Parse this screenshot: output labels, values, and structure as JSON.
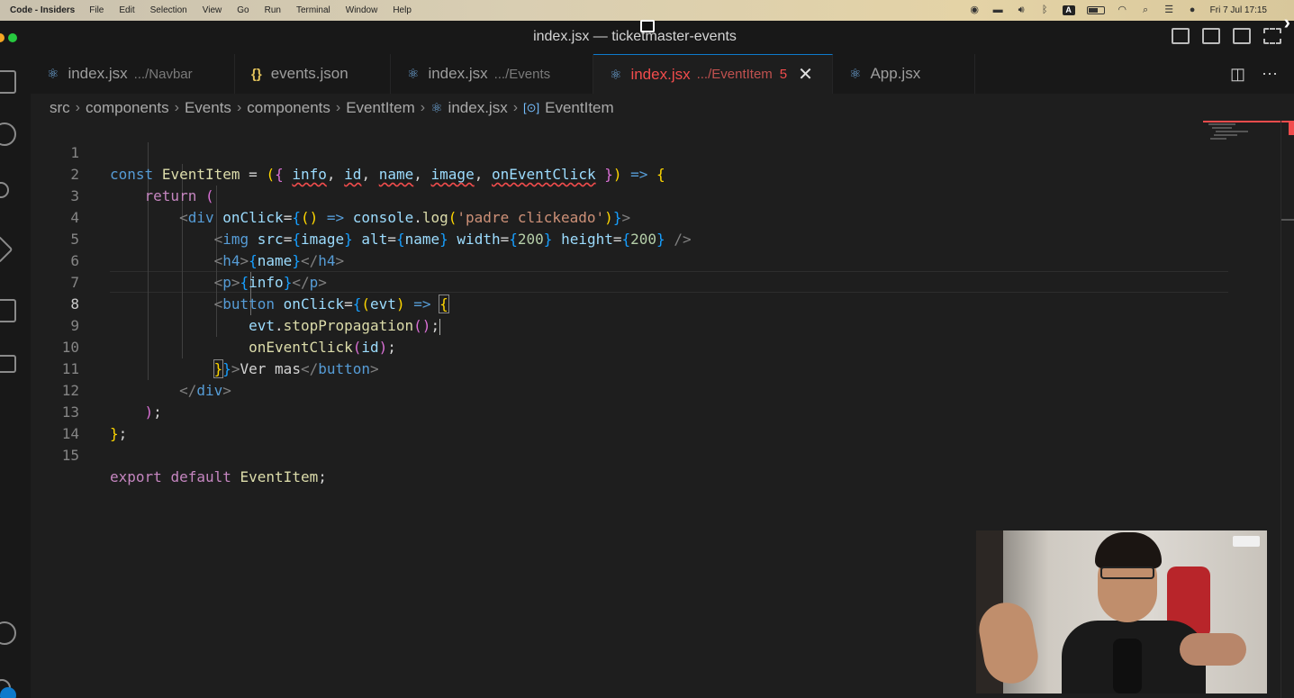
{
  "menubar": {
    "app_name": "Code - Insiders",
    "items": [
      "File",
      "Edit",
      "Selection",
      "View",
      "Go",
      "Run",
      "Terminal",
      "Window",
      "Help"
    ],
    "clock": "Fri 7 Jul  17:15",
    "keyboard_indicator": "A"
  },
  "window": {
    "title": "index.jsx — ticketmaster-events"
  },
  "tabs": [
    {
      "label": "index.jsx",
      "description": ".../Navbar",
      "icon": "react-icon"
    },
    {
      "label": "events.json",
      "description": "",
      "icon": "json-icon",
      "icon_glyph": "{}"
    },
    {
      "label": "index.jsx",
      "description": ".../Events",
      "icon": "react-icon"
    },
    {
      "label": "index.jsx",
      "description": ".../EventItem",
      "icon": "react-icon",
      "active": true,
      "problems": "5",
      "close_glyph": "✕"
    },
    {
      "label": "App.jsx",
      "description": "",
      "icon": "react-icon"
    }
  ],
  "breadcrumb": [
    "src",
    "components",
    "Events",
    "components",
    "EventItem",
    "index.jsx",
    "EventItem"
  ],
  "editor": {
    "current_line": 8,
    "line_numbers": [
      "1",
      "2",
      "3",
      "4",
      "5",
      "6",
      "7",
      "8",
      "9",
      "10",
      "11",
      "12",
      "13",
      "14",
      "15"
    ]
  },
  "colors": {
    "error": "#f14c4c",
    "accent": "#0e7acc",
    "editor_bg": "#1e1e1e"
  }
}
